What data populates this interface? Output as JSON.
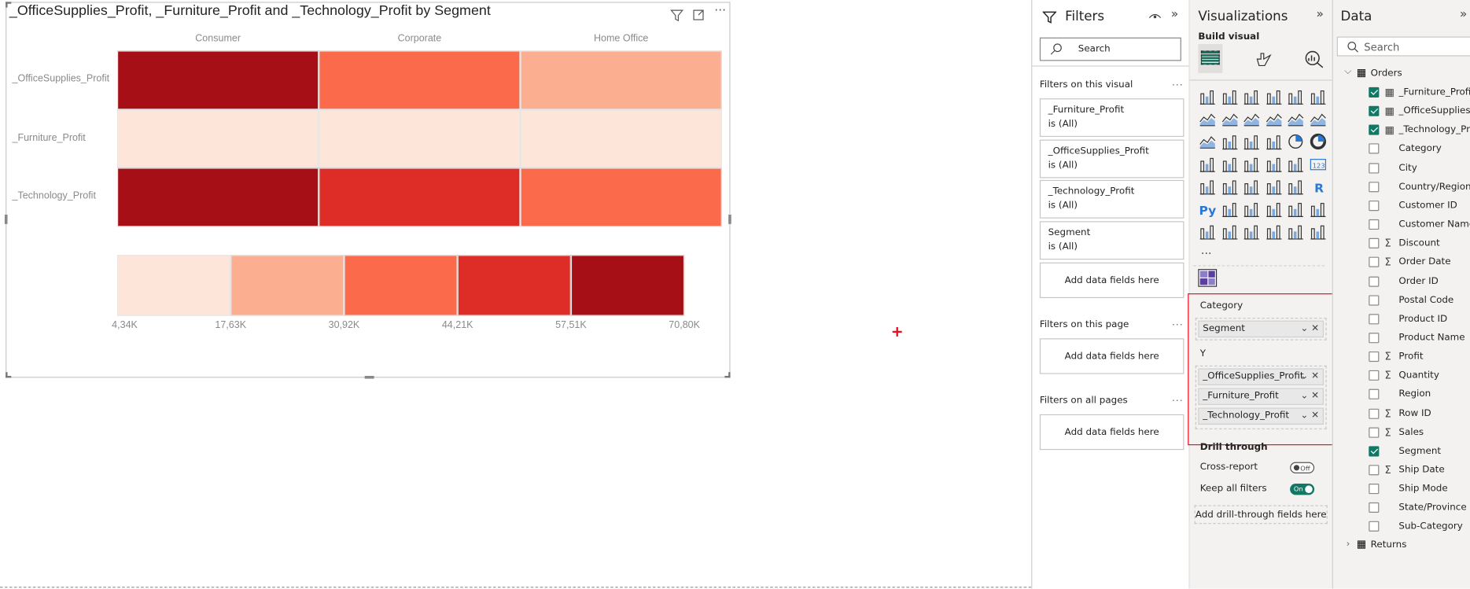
{
  "visual": {
    "title": "_OfficeSupplies_Profit, _Furniture_Profit and _Technology_Profit by Segment",
    "icons": [
      "filter-icon",
      "focus-mode-icon",
      "more-options-icon"
    ]
  },
  "chart_data": {
    "type": "heatmap",
    "title": "_OfficeSupplies_Profit, _Furniture_Profit and _Technology_Profit by Segment",
    "columns": [
      "Consumer",
      "Corporate",
      "Home Office"
    ],
    "rows": [
      "_OfficeSupplies_Profit",
      "_Furniture_Profit",
      "_Technology_Profit"
    ],
    "cell_colors": [
      [
        "#a50f15",
        "#fb6a4a",
        "#fcae91"
      ],
      [
        "#fee5d9",
        "#fee5d9",
        "#fee5d9"
      ],
      [
        "#a50f15",
        "#de2d26",
        "#fb6a4a"
      ]
    ],
    "legend": {
      "colors": [
        "#fee5d9",
        "#fcae91",
        "#fb6a4a",
        "#de2d26",
        "#a50f15"
      ],
      "ticks": [
        "4,34K",
        "17,63K",
        "30,92K",
        "44,21K",
        "57,51K",
        "70,80K"
      ]
    }
  },
  "filters": {
    "title": "Filters",
    "search_placeholder": "Search",
    "on_visual": "Filters on this visual",
    "cards": [
      {
        "name": "_Furniture_Profit",
        "state": "is (All)"
      },
      {
        "name": "_OfficeSupplies_Profit",
        "state": "is (All)"
      },
      {
        "name": "_Technology_Profit",
        "state": "is (All)"
      },
      {
        "name": "Segment",
        "state": "is (All)"
      }
    ],
    "add_fields": "Add data fields here",
    "on_page": "Filters on this page",
    "on_all": "Filters on all pages",
    "more": "..."
  },
  "viz": {
    "title": "Visualizations",
    "build_visual": "Build visual",
    "gallery": [
      "stacked-bar",
      "stacked-column",
      "clustered-bar",
      "clustered-column",
      "100-bar",
      "100-column",
      "line",
      "area",
      "stacked-area",
      "100-area",
      "line-column",
      "line-clustered-column",
      "ribbon",
      "waterfall",
      "funnel",
      "scatter",
      "pie",
      "donut",
      "treemap",
      "map",
      "filled-map",
      "azure-map",
      "gauge",
      "card",
      "multirow-card",
      "kpi",
      "slicer",
      "table",
      "matrix",
      "r-visual",
      "python-visual",
      "key-influencers",
      "decomposition-tree",
      "qa",
      "smart-narrative",
      "metrics",
      "paginated",
      "power-apps",
      "power-automate",
      "arcgis",
      "power-bi-diamond",
      "chevron"
    ],
    "more": "...",
    "category_label": "Category",
    "category_field": "Segment",
    "y_label": "Y",
    "y_fields": [
      "_OfficeSupplies_Profit",
      "_Furniture_Profit",
      "_Technology_Profit"
    ],
    "drill_through": "Drill through",
    "cross_report": "Cross-report",
    "cross_report_state": "Off",
    "keep_filters": "Keep all filters",
    "keep_filters_state": "On",
    "add_drill": "Add drill-through fields here",
    "accent": "#117865",
    "highlight": "#e81123"
  },
  "data": {
    "title": "Data",
    "search_placeholder": "Search",
    "table": "Orders",
    "fields": [
      {
        "name": "_Furniture_Profit",
        "checked": true,
        "icon": "calc"
      },
      {
        "name": "_OfficeSupplies...",
        "checked": true,
        "icon": "calc"
      },
      {
        "name": "_Technology_Pr...",
        "checked": true,
        "icon": "calc"
      },
      {
        "name": "Category",
        "checked": false,
        "icon": ""
      },
      {
        "name": "City",
        "checked": false,
        "icon": ""
      },
      {
        "name": "Country/Region",
        "checked": false,
        "icon": ""
      },
      {
        "name": "Customer ID",
        "checked": false,
        "icon": ""
      },
      {
        "name": "Customer Name",
        "checked": false,
        "icon": ""
      },
      {
        "name": "Discount",
        "checked": false,
        "icon": "sigma"
      },
      {
        "name": "Order Date",
        "checked": false,
        "icon": "sigma"
      },
      {
        "name": "Order ID",
        "checked": false,
        "icon": ""
      },
      {
        "name": "Postal Code",
        "checked": false,
        "icon": ""
      },
      {
        "name": "Product ID",
        "checked": false,
        "icon": ""
      },
      {
        "name": "Product Name",
        "checked": false,
        "icon": ""
      },
      {
        "name": "Profit",
        "checked": false,
        "icon": "sigma"
      },
      {
        "name": "Quantity",
        "checked": false,
        "icon": "sigma"
      },
      {
        "name": "Region",
        "checked": false,
        "icon": ""
      },
      {
        "name": "Row ID",
        "checked": false,
        "icon": "sigma"
      },
      {
        "name": "Sales",
        "checked": false,
        "icon": "sigma"
      },
      {
        "name": "Segment",
        "checked": true,
        "icon": ""
      },
      {
        "name": "Ship Date",
        "checked": false,
        "icon": "sigma"
      },
      {
        "name": "Ship Mode",
        "checked": false,
        "icon": ""
      },
      {
        "name": "State/Province",
        "checked": false,
        "icon": ""
      },
      {
        "name": "Sub-Category",
        "checked": false,
        "icon": ""
      }
    ],
    "table2": "Returns"
  }
}
